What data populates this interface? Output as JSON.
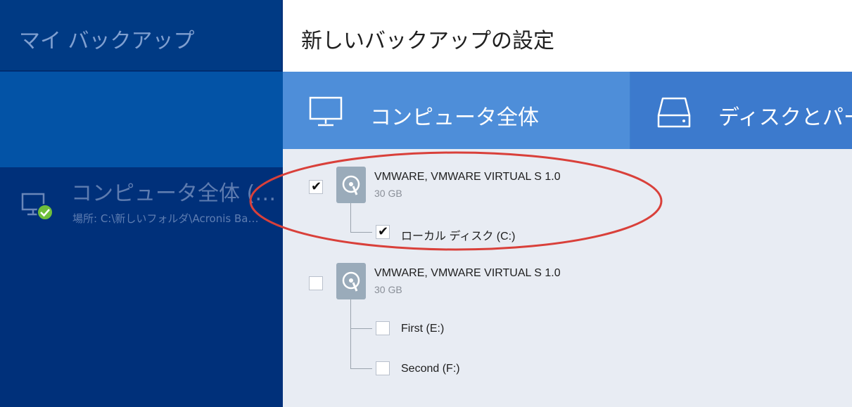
{
  "sidebar": {
    "title": "マイ バックアップ",
    "backup_item": {
      "title": "コンピュータ全体 (…",
      "location": "場所: C:\\新しいフォルダ\\Acronis Ba…"
    }
  },
  "header": {
    "title": "新しいバックアップの設定"
  },
  "tabs": [
    {
      "label": "コンピュータ全体",
      "icon": "monitor-icon"
    },
    {
      "label": "ディスクとパー",
      "icon": "hard-drive-icon"
    }
  ],
  "disks": [
    {
      "name": "VMWARE, VMWARE VIRTUAL S 1.0",
      "size": "30 GB",
      "checked": true,
      "partitions": [
        {
          "label": "ローカル ディスク (C:)",
          "checked": true
        }
      ]
    },
    {
      "name": "VMWARE, VMWARE VIRTUAL S 1.0",
      "size": "30 GB",
      "checked": false,
      "partitions": [
        {
          "label": "First (E:)",
          "checked": false
        },
        {
          "label": "Second (F:)",
          "checked": false
        }
      ]
    }
  ],
  "colors": {
    "sidebar_bg": "#00307a",
    "sidebar_selected": "#0353a6",
    "tab_active": "#4e8ed9",
    "tab_inactive": "#3c7acd",
    "status_ok": "#6fbf3b",
    "annotation": "#d9403a"
  }
}
